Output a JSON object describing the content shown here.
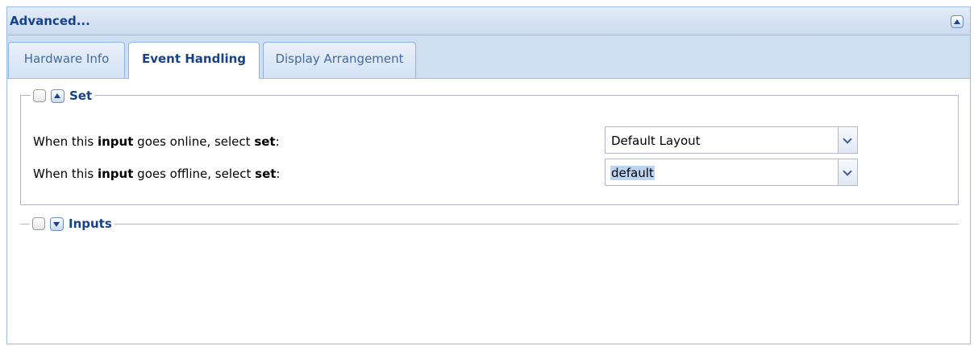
{
  "panel": {
    "title": "Advanced..."
  },
  "tabs": [
    {
      "label": "Hardware Info",
      "active": false
    },
    {
      "label": "Event Handling",
      "active": true
    },
    {
      "label": "Display Arrangement",
      "active": false
    }
  ],
  "set_section": {
    "title": "Set",
    "rows": [
      {
        "label_prefix": "When this ",
        "label_bold1": "input",
        "label_middle": " goes online, select ",
        "label_bold2": "set",
        "label_suffix": ":",
        "value": "Default Layout"
      },
      {
        "label_prefix": "When this ",
        "label_bold1": "input",
        "label_middle": " goes offline, select ",
        "label_bold2": "set",
        "label_suffix": ":",
        "value": "default"
      }
    ]
  },
  "inputs_section": {
    "title": "Inputs"
  },
  "colors": {
    "header_text": "#15428b",
    "border": "#99bbe8",
    "tab_bar": "#cfdff2",
    "selection_highlight": "#bcd4ef"
  },
  "icons": {
    "panel_collapse": "chevron-up-icon",
    "set_toggle": "chevron-up-icon",
    "inputs_toggle": "chevron-down-icon",
    "combo_trigger": "chevron-down-icon"
  }
}
